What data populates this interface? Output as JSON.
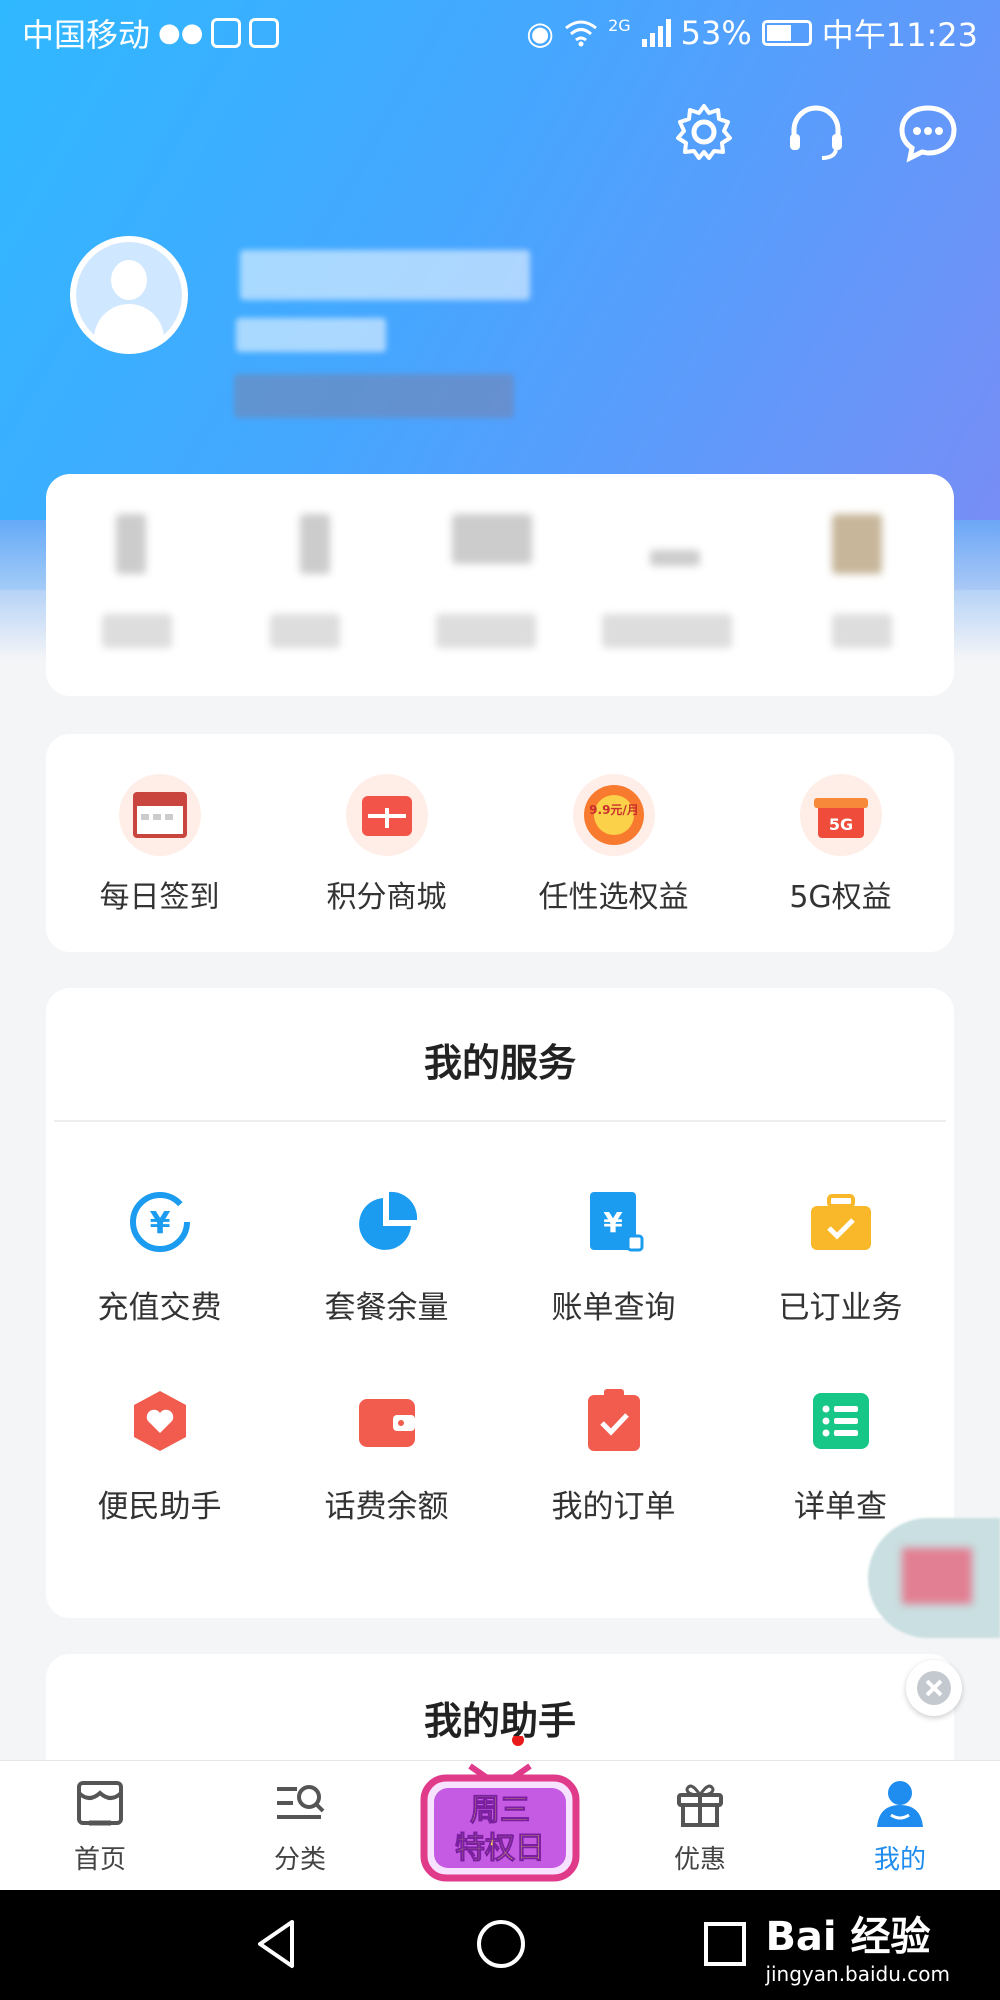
{
  "status_bar": {
    "carrier": "中国移动",
    "network": "2G",
    "battery": "53%",
    "time": "中午11:23"
  },
  "header_icons": [
    "gear-icon",
    "headset-icon",
    "chat-bubble-icon"
  ],
  "quick_actions": [
    {
      "label": "每日签到",
      "icon": "calendar-checkin-icon"
    },
    {
      "label": "积分商城",
      "icon": "points-mall-icon"
    },
    {
      "label": "任性选权益",
      "icon": "benefit-select-icon",
      "badge": "9.9元/月"
    },
    {
      "label": "5G权益",
      "icon": "5g-gift-icon",
      "badge": "5G"
    }
  ],
  "services": {
    "title": "我的服务",
    "items": [
      {
        "label": "充值交费",
        "icon": "yuan-refresh-icon"
      },
      {
        "label": "套餐余量",
        "icon": "pie-chart-icon"
      },
      {
        "label": "账单查询",
        "icon": "bill-yuan-icon"
      },
      {
        "label": "已订业务",
        "icon": "briefcase-check-icon"
      },
      {
        "label": "便民助手",
        "icon": "heart-hexagon-icon"
      },
      {
        "label": "话费余额",
        "icon": "wallet-icon"
      },
      {
        "label": "我的订单",
        "icon": "clipboard-check-icon"
      },
      {
        "label": "详单查",
        "icon": "list-icon"
      }
    ]
  },
  "assistant": {
    "title": "我的助手"
  },
  "tabbar": {
    "tabs": [
      {
        "label": "首页",
        "icon": "home-store-icon"
      },
      {
        "label": "分类",
        "icon": "category-search-icon"
      },
      {
        "label": "优惠",
        "icon": "gift-icon"
      },
      {
        "label": "我的",
        "icon": "user-icon",
        "active": true
      }
    ],
    "promo": {
      "line1": "周三",
      "line2": "特权日"
    }
  },
  "watermark": {
    "brand": "Bai 经验",
    "url": "jingyan.baidu.com"
  },
  "colors": {
    "accent": "#1f8cf0",
    "red": "#f25c4f",
    "yellow": "#f8b82a",
    "green": "#16c787"
  }
}
